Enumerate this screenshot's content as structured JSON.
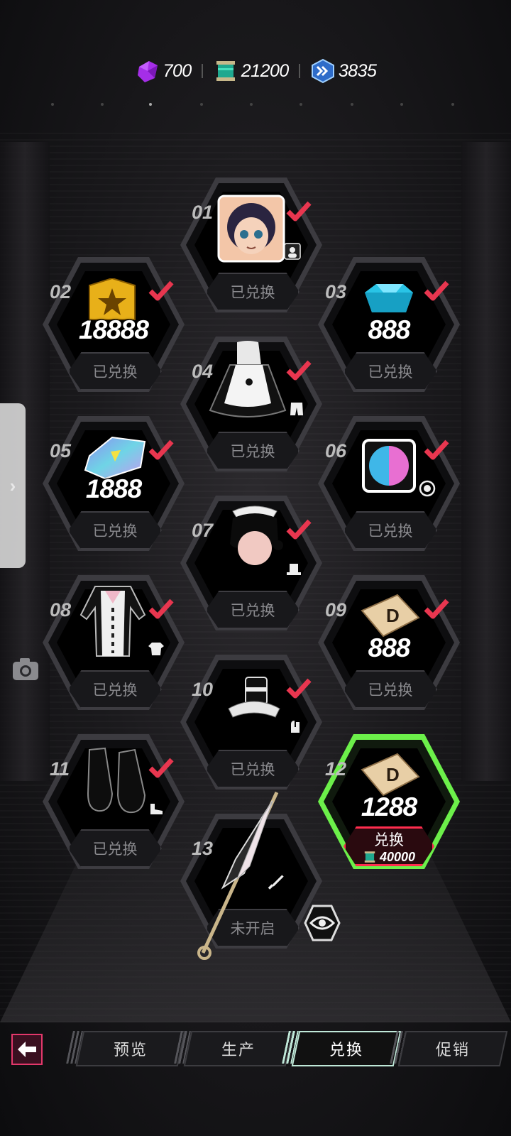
{
  "currencies": [
    {
      "icon": "purple-gem-icon",
      "value": "700"
    },
    {
      "icon": "green-scroll-icon",
      "value": "21200"
    },
    {
      "icon": "blue-chevron-token-icon",
      "value": "3835"
    }
  ],
  "nodes": [
    {
      "num": "01",
      "reward": "",
      "item": "avatar-portrait",
      "button": "已兑换",
      "claimed": true
    },
    {
      "num": "02",
      "reward": "18888",
      "item": "gold-badge",
      "button": "已兑换",
      "claimed": true
    },
    {
      "num": "03",
      "reward": "888",
      "item": "blue-crystal",
      "button": "已兑换",
      "claimed": true
    },
    {
      "num": "04",
      "reward": "",
      "item": "maid-skirt",
      "button": "已兑换",
      "claimed": true
    },
    {
      "num": "05",
      "reward": "1888",
      "item": "holo-ticket",
      "button": "已兑换",
      "claimed": true
    },
    {
      "num": "06",
      "reward": "",
      "item": "color-swatch",
      "button": "已兑换",
      "claimed": true
    },
    {
      "num": "07",
      "reward": "",
      "item": "maid-headpiece",
      "button": "已兑换",
      "claimed": true
    },
    {
      "num": "08",
      "reward": "",
      "item": "maid-top",
      "button": "已兑换",
      "claimed": true
    },
    {
      "num": "09",
      "reward": "888",
      "item": "d-plate",
      "button": "已兑换",
      "claimed": true
    },
    {
      "num": "10",
      "reward": "",
      "item": "mini-top-hat",
      "button": "已兑换",
      "claimed": true
    },
    {
      "num": "11",
      "reward": "",
      "item": "black-shoes",
      "button": "已兑换",
      "claimed": true
    },
    {
      "num": "12",
      "reward": "1288",
      "item": "d-plate",
      "button": "兑换",
      "cost": "40000",
      "claimed": false
    },
    {
      "num": "13",
      "reward": "",
      "item": "parasol",
      "button": "未开启",
      "claimed": false
    }
  ],
  "tabs": [
    {
      "label": "预览"
    },
    {
      "label": "生产"
    },
    {
      "label": "兑换"
    },
    {
      "label": "促销"
    }
  ],
  "colors": {
    "check": "#e8364f",
    "active_ring": "#6cf04a",
    "redeem_border": "#ff2d4e",
    "tab_active": "#bfe8d8"
  }
}
